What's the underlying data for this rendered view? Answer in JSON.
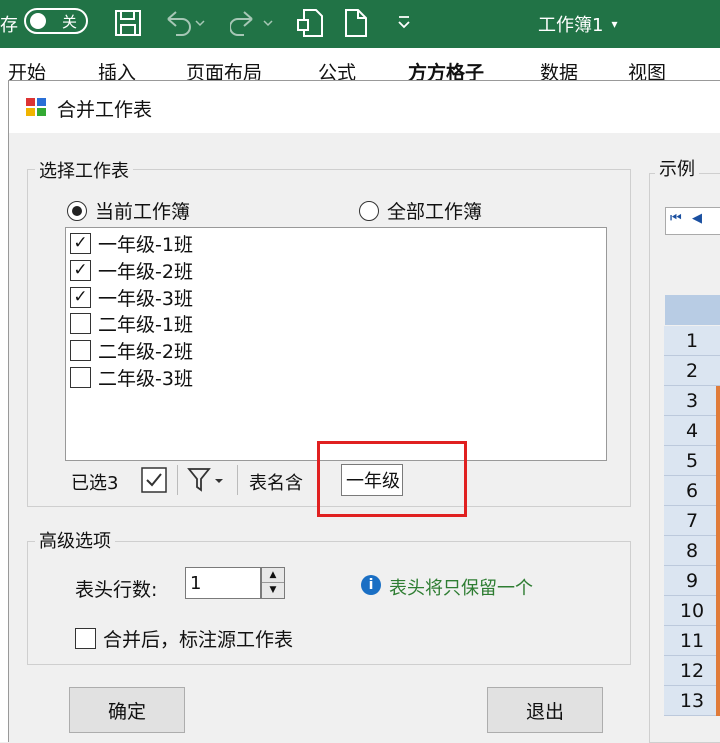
{
  "ribbon": {
    "save_prefix": "存",
    "autosave_label": "关",
    "workbook_title": "工作簿1",
    "tabs": [
      "开始",
      "插入",
      "页面布局",
      "公式",
      "方方格子",
      "数据",
      "视图"
    ]
  },
  "dialog": {
    "title": "合并工作表",
    "select_group_title": "选择工作表",
    "radio_current": "当前工作簿",
    "radio_all": "全部工作簿",
    "sheets": [
      {
        "label": "一年级-1班",
        "checked": true
      },
      {
        "label": "一年级-2班",
        "checked": true
      },
      {
        "label": "一年级-3班",
        "checked": true
      },
      {
        "label": "二年级-1班",
        "checked": false
      },
      {
        "label": "二年级-2班",
        "checked": false
      },
      {
        "label": "二年级-3班",
        "checked": false
      }
    ],
    "selected_count": "已选3",
    "name_filter_label": "表名含",
    "name_filter_value": "一年级",
    "advanced_group_title": "高级选项",
    "header_rows_label": "表头行数:",
    "header_rows_value": "1",
    "header_info": "表头将只保留一个",
    "annotate_label": "合并后，标注源工作表",
    "ok_label": "确定",
    "exit_label": "退出",
    "example_title": "示例",
    "example_rows": [
      "1",
      "2",
      "3",
      "4",
      "5",
      "6",
      "7",
      "8",
      "9",
      "10",
      "11",
      "12",
      "13"
    ]
  },
  "colors": {
    "ribbon": "#217346",
    "highlight_box": "#e02020",
    "info": "#1a6fc4",
    "info_text": "#2e7d32"
  }
}
